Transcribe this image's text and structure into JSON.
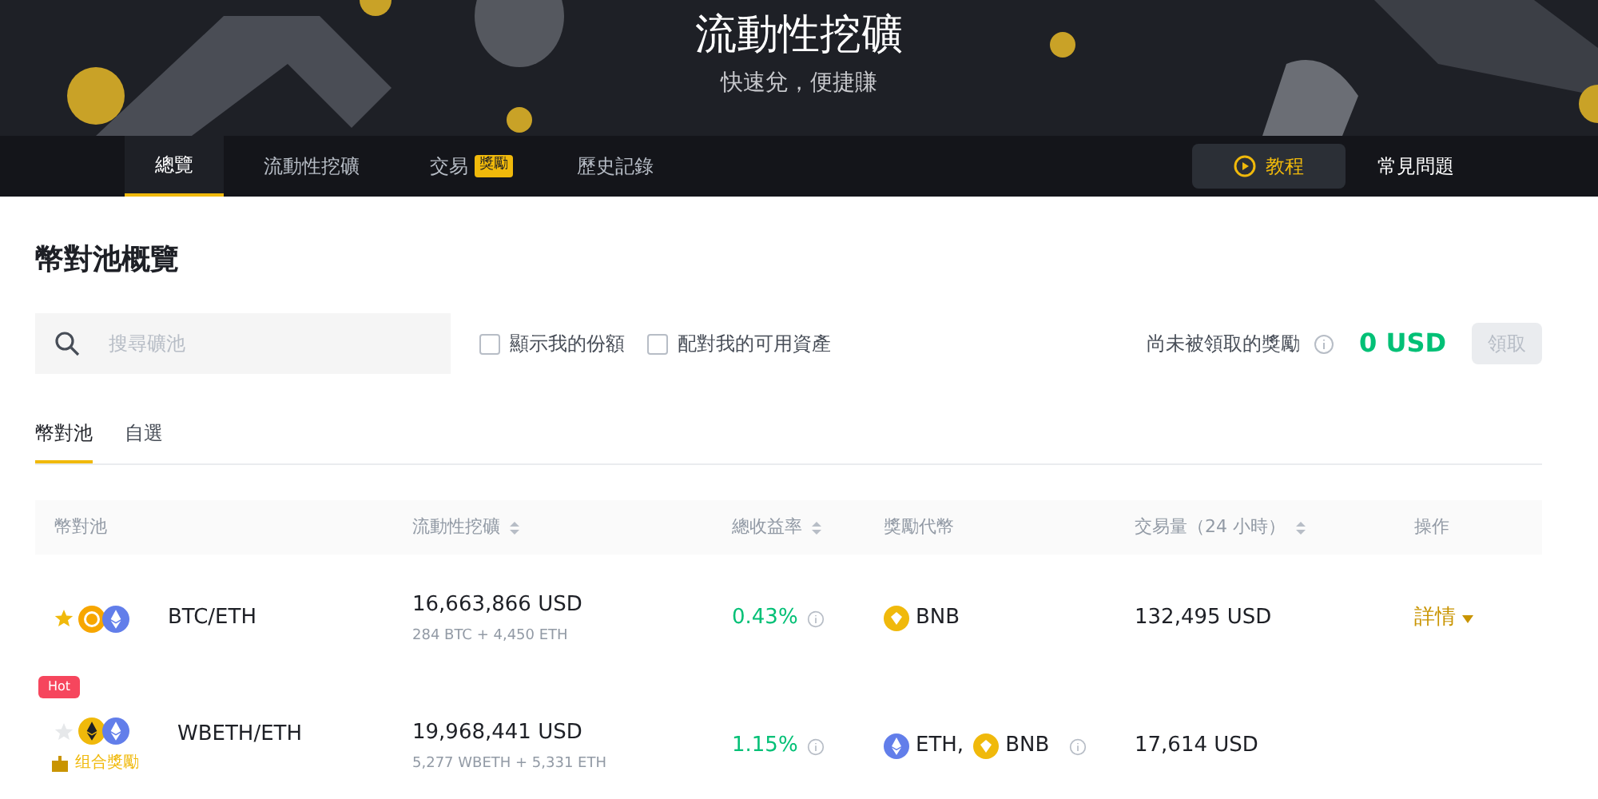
{
  "banner": {
    "title": "流動性挖礦",
    "subtitle": "快速兌，便捷賺"
  },
  "nav": {
    "tabs": [
      {
        "label": "總覽",
        "selected": true
      },
      {
        "label": "流動性挖礦",
        "selected": false
      },
      {
        "label": "交易",
        "selected": false,
        "badge": "獎勵"
      },
      {
        "label": "歷史記錄",
        "selected": false
      }
    ],
    "tutorial_button": "教程",
    "faq_link": "常見問題"
  },
  "section_title": "幣對池概覽",
  "search": {
    "placeholder": "搜尋礦池"
  },
  "filters": [
    {
      "label": "顯示我的份額",
      "checked": false
    },
    {
      "label": "配對我的可用資產",
      "checked": false
    }
  ],
  "rewards": {
    "label": "尚未被領取的獎勵",
    "amount": "0 USD",
    "claim_button": "領取",
    "claim_disabled": true
  },
  "subtabs": [
    {
      "label": "幣對池",
      "selected": true
    },
    {
      "label": "自選",
      "selected": false
    }
  ],
  "table": {
    "columns": [
      {
        "label": "幣對池",
        "sortable": false
      },
      {
        "label": "流動性挖礦",
        "sortable": true
      },
      {
        "label": "總收益率",
        "sortable": true
      },
      {
        "label": "獎勵代幣",
        "sortable": false
      },
      {
        "label": "交易量（24 小時）",
        "sortable": true
      },
      {
        "label": "操作",
        "sortable": false
      }
    ],
    "rows": [
      {
        "favorite": true,
        "hot": null,
        "combo": null,
        "coins": [
          {
            "kind": "btc"
          },
          {
            "kind": "eth"
          }
        ],
        "pair": "BTC/ETH",
        "liquidity": "16,663,866 USD",
        "liquidity_detail": "284 BTC + 4,450 ETH",
        "apr": "0.43%",
        "rewards": [
          {
            "kind": "bnb",
            "symbol": "BNB"
          }
        ],
        "reward_info": false,
        "volume": "132,495 USD",
        "action": "詳情"
      },
      {
        "favorite": false,
        "hot": "Hot",
        "combo": "组合獎勵",
        "coins": [
          {
            "kind": "wbeth"
          },
          {
            "kind": "eth"
          }
        ],
        "pair": "WBETH/ETH",
        "liquidity": "19,968,441 USD",
        "liquidity_detail": "5,277 WBETH + 5,331 ETH",
        "apr": "1.15%",
        "rewards": [
          {
            "kind": "eth",
            "symbol": "ETH,"
          },
          {
            "kind": "bnb",
            "symbol": "BNB"
          }
        ],
        "reward_info": true,
        "volume": "17,614 USD",
        "action": null
      }
    ]
  }
}
